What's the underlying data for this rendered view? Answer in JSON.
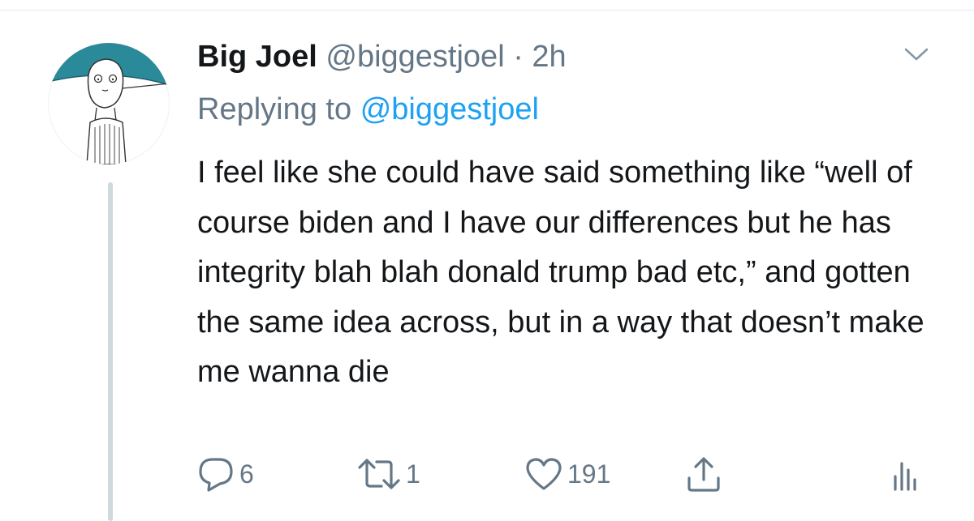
{
  "tweet": {
    "display_name": "Big Joel",
    "handle": "@biggestjoel",
    "separator": "·",
    "time": "2h",
    "replying_prefix": "Replying to",
    "replying_to": "@biggestjoel",
    "text": "I feel like she could have said something like “well of course biden and I have our differences but he has integrity blah blah donald trump bad etc,” and gotten the same idea across, but in a way that doesn’t make me wanna die"
  },
  "actions": {
    "reply_count": "6",
    "retweet_count": "1",
    "like_count": "191"
  },
  "colors": {
    "text": "#14171a",
    "secondary": "#657786",
    "link": "#1da1f2",
    "avatar_band": "#2b8a9a",
    "thread_line": "#cfd9de"
  },
  "icons": [
    "reply-icon",
    "retweet-icon",
    "like-icon",
    "share-icon",
    "analytics-icon",
    "chevron-down-icon"
  ]
}
